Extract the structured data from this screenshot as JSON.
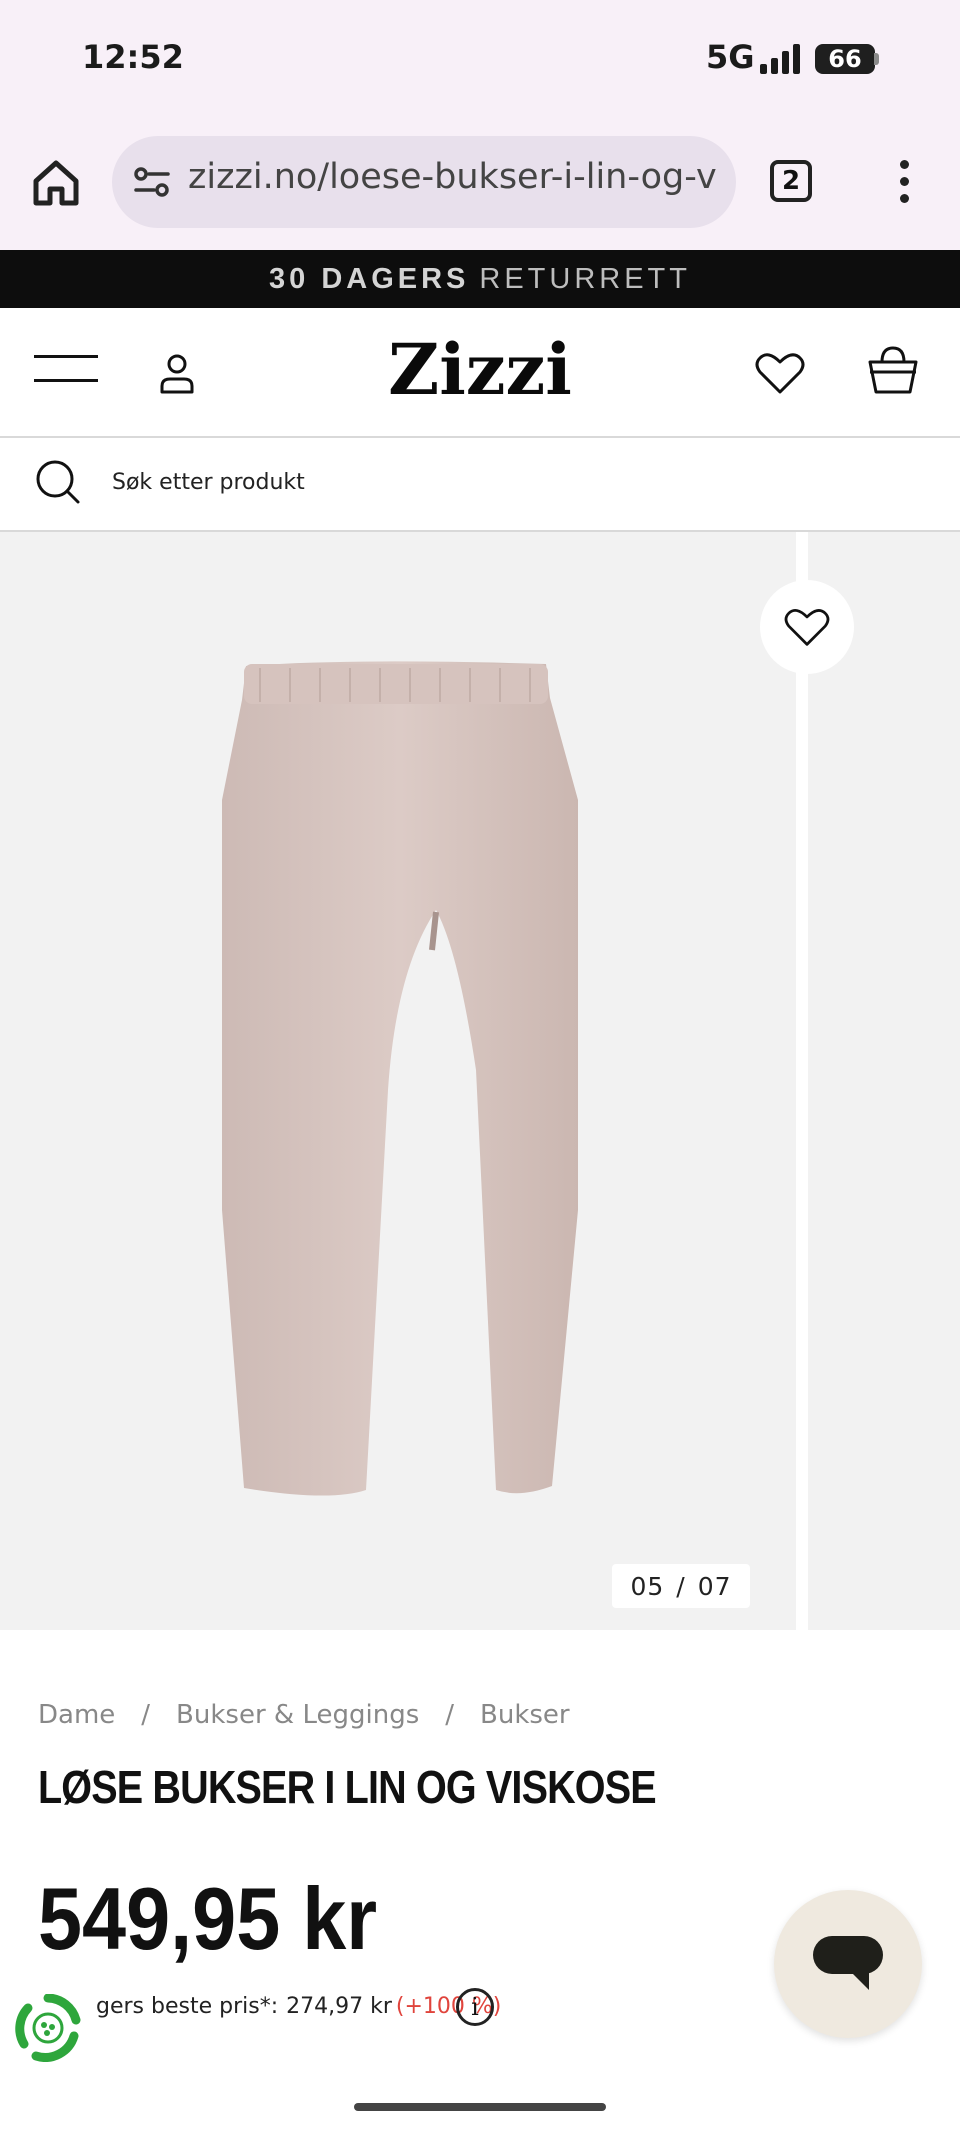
{
  "status_bar": {
    "time": "12:52",
    "network": "5G",
    "battery": "66"
  },
  "browser": {
    "url": "zizzi.no/loese-bukser-i-lin-og-viskose",
    "tab_count": "2"
  },
  "promo": {
    "bold": "30 DAGERS",
    "rest": "RETURRETT"
  },
  "header": {
    "logo": "Zizzi"
  },
  "search": {
    "placeholder": "Søk etter produkt"
  },
  "gallery": {
    "current": "05",
    "separator": "/",
    "total": "07"
  },
  "product": {
    "breadcrumb": [
      "Dame",
      "/",
      "Bukser & Leggings",
      "/",
      "Bukser"
    ],
    "title": "LØSE BUKSER I LIN OG VISKOSE",
    "price": "549,95 kr",
    "lowest_price_label": "gers beste pris*:",
    "lowest_price_value": "274,97 kr",
    "lowest_price_change": "(+100 %)"
  },
  "colors": {
    "promo_bg": "#0d0d0d",
    "accent_red": "#e0443c",
    "chat_bg": "#efe9df"
  }
}
